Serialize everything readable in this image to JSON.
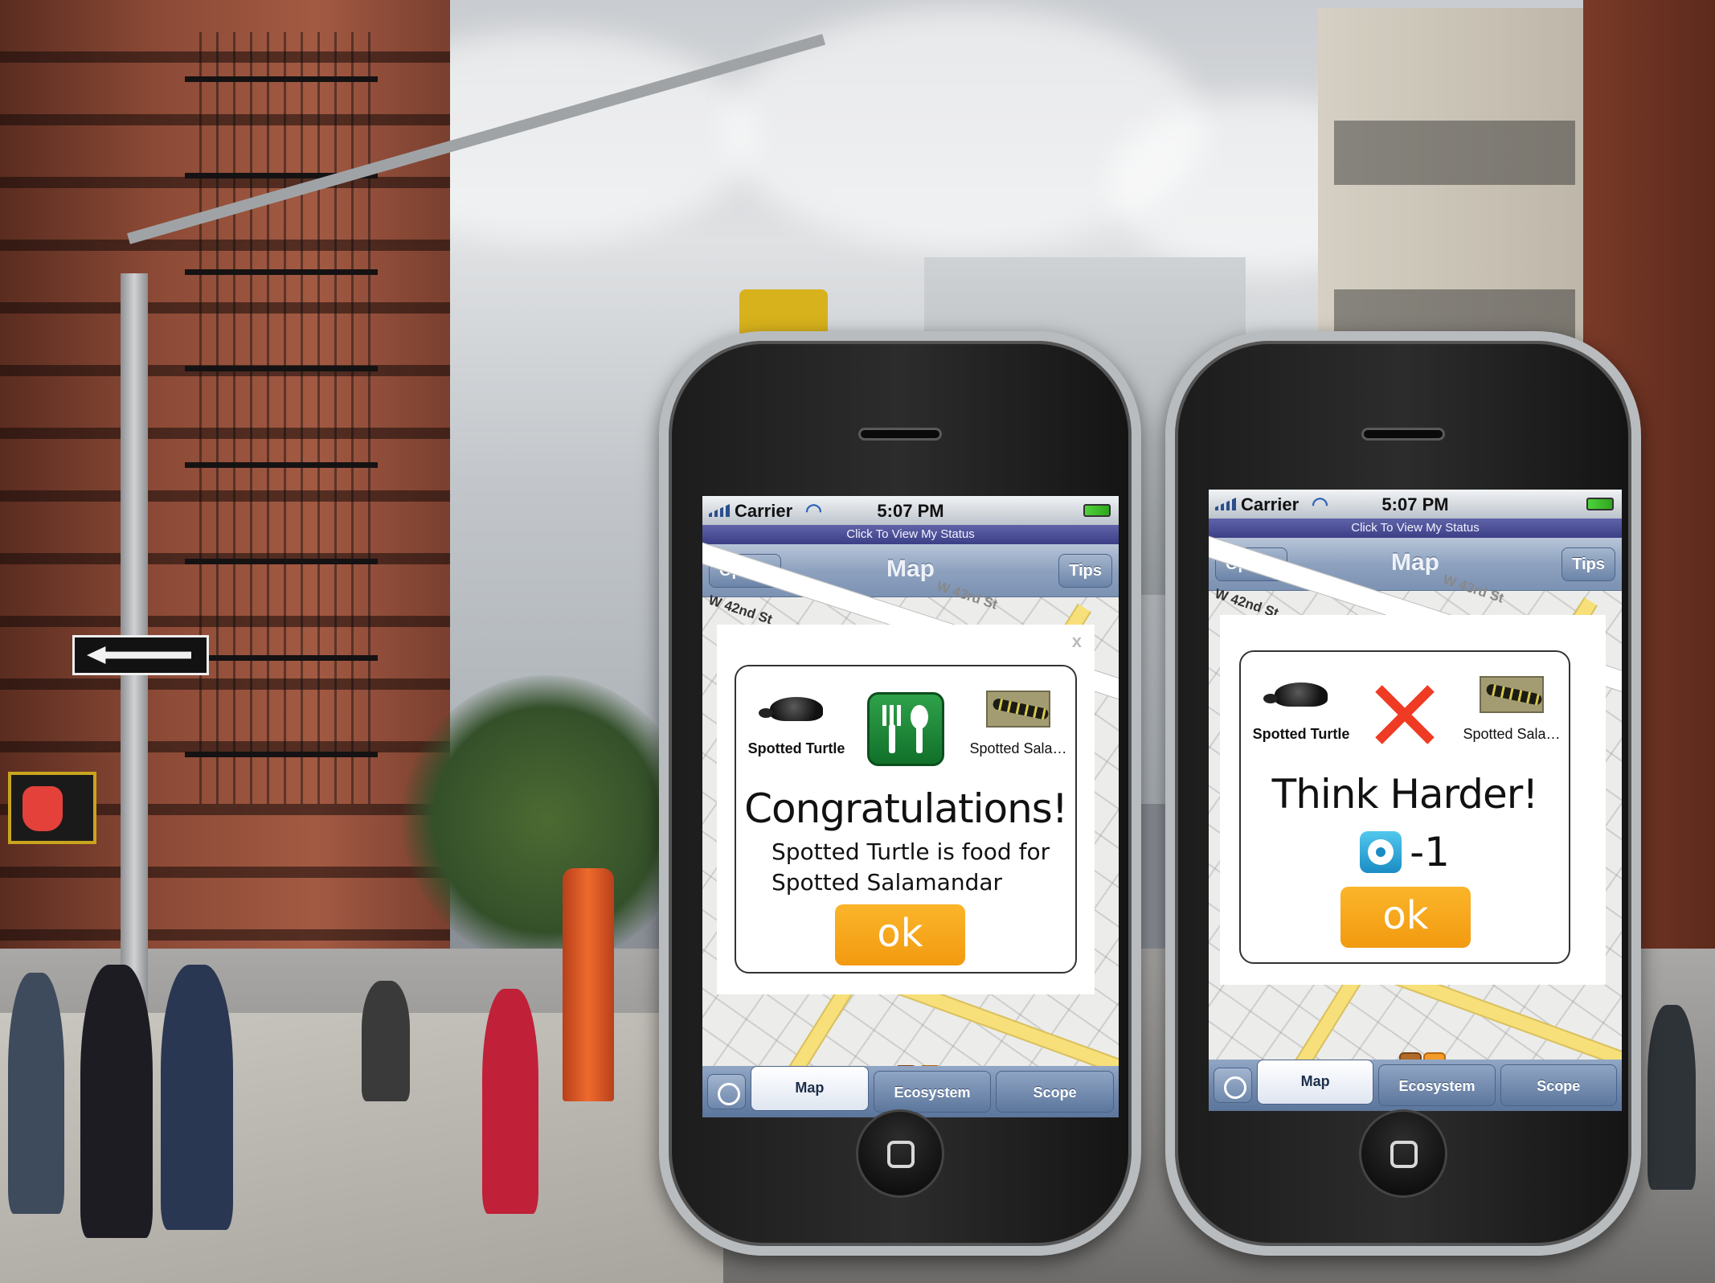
{
  "phones": [
    {
      "status": {
        "carrier": "Carrier",
        "time": "5:07 PM"
      },
      "status_link": "Click To View My Status",
      "nav": {
        "left_button": "Option",
        "title": "Map",
        "right_button": "Tips"
      },
      "map_labels": {
        "street_a": "W 43rd St",
        "street_b": "W 42nd St"
      },
      "dialog": {
        "close": "x",
        "left_species": "Spotted Turtle",
        "right_species": "Spotted Sala…",
        "center_icon": "fork-spoon-icon",
        "title": "Congratulations!",
        "message_line1": "Spotted Turtle is food for",
        "message_line2": "Spotted Salamandar",
        "ok": "ok"
      },
      "tabs": [
        "Map",
        "Ecosystem",
        "Scope"
      ],
      "active_tab": "Map"
    },
    {
      "status": {
        "carrier": "Carrier",
        "time": "5:07 PM"
      },
      "status_link": "Click To View My Status",
      "nav": {
        "left_button": "Option",
        "title": "Map",
        "right_button": "Tips"
      },
      "map_labels": {
        "street_a": "W 43rd St",
        "street_b": "W 42nd St"
      },
      "dialog": {
        "left_species": "Spotted Turtle",
        "right_species": "Spotted Sala…",
        "center_icon": "red-x-icon",
        "title": "Think Harder!",
        "penalty_icon": "energy-token-icon",
        "penalty_value": "-1",
        "ok": "ok"
      },
      "tabs": [
        "Map",
        "Ecosystem",
        "Scope"
      ],
      "active_tab": "Map"
    }
  ],
  "background": {
    "sign": "ONE WAY"
  },
  "colors": {
    "ok_button": "#f29a10",
    "food_icon": "#1f8a38",
    "wrong_icon": "#ef3b24",
    "status_link_bar": "#4b4f96"
  }
}
